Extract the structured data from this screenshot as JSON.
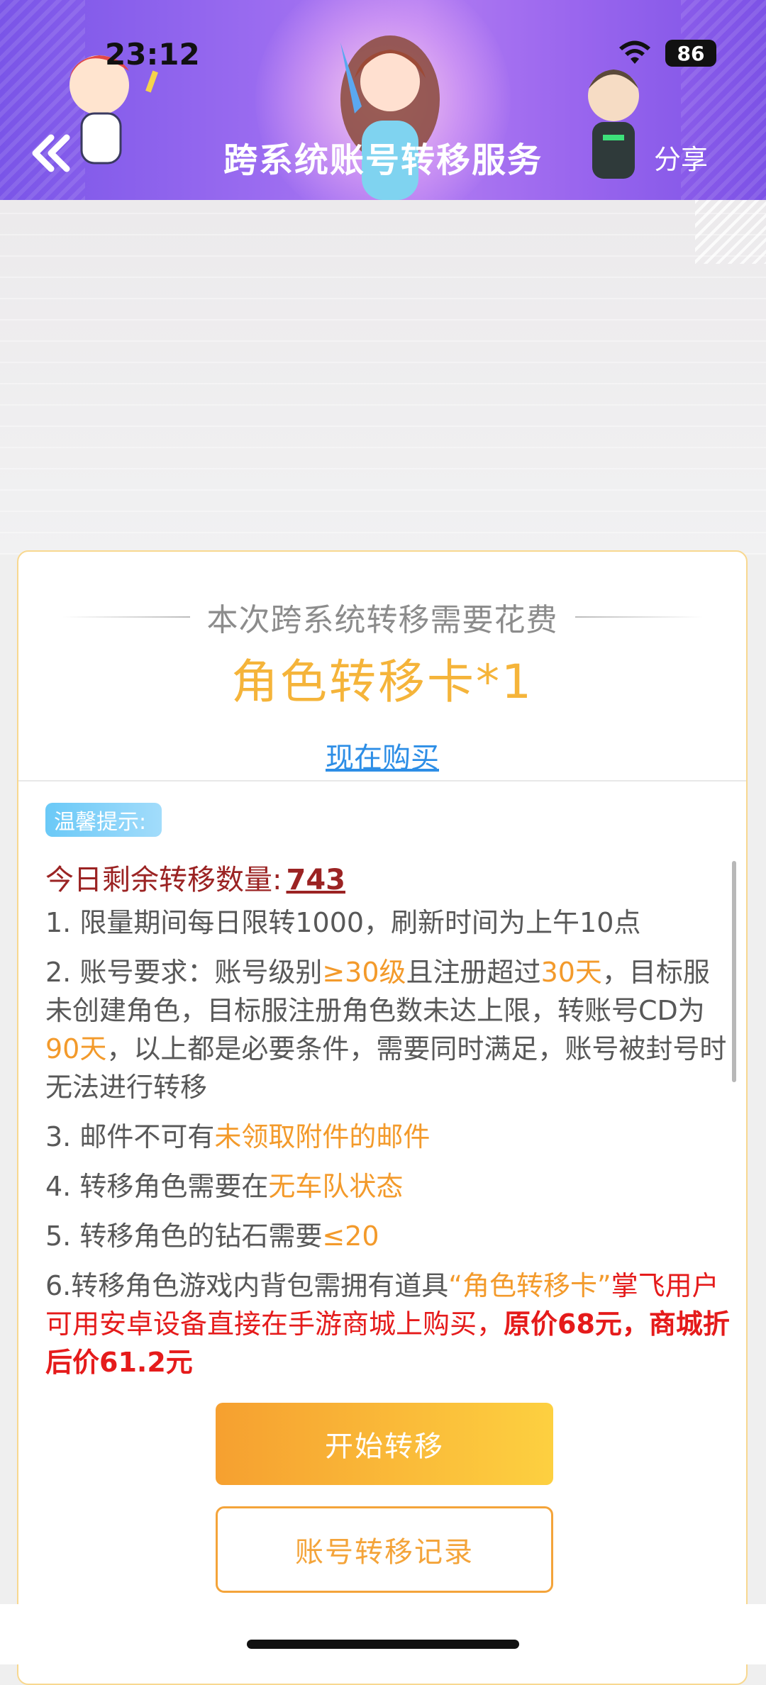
{
  "status_bar": {
    "time": "23:12",
    "battery": "86"
  },
  "header": {
    "title": "跨系统账号转移服务",
    "share_label": "分享"
  },
  "cost": {
    "label": "本次跨系统转移需要花费",
    "item": "角色转移卡*1",
    "buy_link": "现在购买"
  },
  "tips": {
    "badge": "温馨提示:",
    "remaining_label": "今日剩余转移数量:",
    "remaining_count": "743",
    "rule1": "1. 限量期间每日限转1000，刷新时间为上午10点",
    "rule2": {
      "p1": "2. 账号要求：账号级别",
      "level": "≥30级",
      "p2": "且注册超过",
      "days": "30天",
      "p3": "，目标服未创建角色，目标服注册角色数未达上限，转账号CD为",
      "cd": "90天",
      "p4": "，以上都是必要条件，需要同时满足，账号被封号时无法进行转移"
    },
    "rule3": {
      "p1": "3. 邮件不可有",
      "hl": "未领取附件的邮件"
    },
    "rule4": {
      "p1": "4. 转移角色需要在",
      "hl": "无车队状态"
    },
    "rule5": {
      "p1": "5. 转移角色的钻石需要",
      "hl": "≤20"
    },
    "rule6": {
      "p1": "6.转移角色游戏内背包需拥有道具",
      "item": "“角色转移卡”",
      "p2": "掌飞用户可用安卓设备直接在手游商城上购买，",
      "price": "原价68元，商城折后价61.2元"
    }
  },
  "buttons": {
    "start": "开始转移",
    "record": "账号转移记录"
  }
}
